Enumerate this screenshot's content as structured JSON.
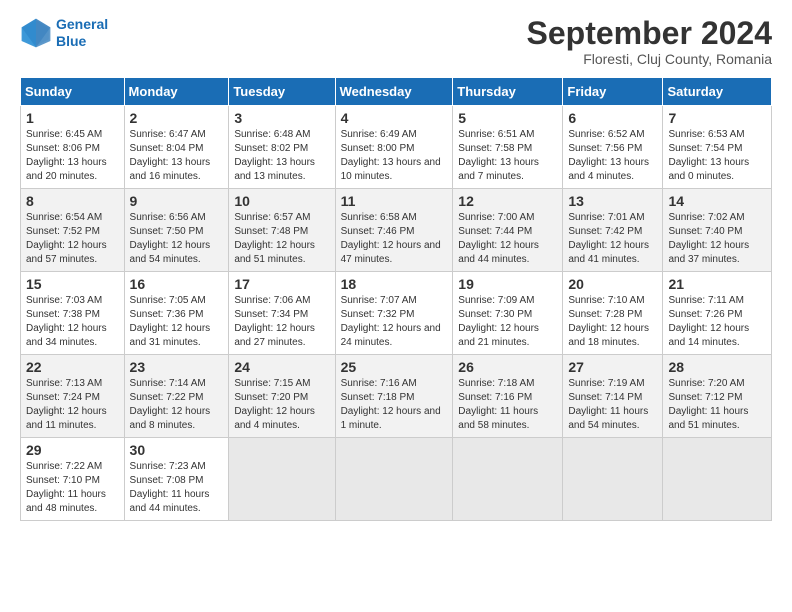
{
  "header": {
    "logo_line1": "General",
    "logo_line2": "Blue",
    "month_title": "September 2024",
    "subtitle": "Floresti, Cluj County, Romania"
  },
  "days_of_week": [
    "Sunday",
    "Monday",
    "Tuesday",
    "Wednesday",
    "Thursday",
    "Friday",
    "Saturday"
  ],
  "weeks": [
    [
      {
        "day": "1",
        "sunrise": "6:45 AM",
        "sunset": "8:06 PM",
        "daylight": "13 hours and 20 minutes."
      },
      {
        "day": "2",
        "sunrise": "6:47 AM",
        "sunset": "8:04 PM",
        "daylight": "13 hours and 16 minutes."
      },
      {
        "day": "3",
        "sunrise": "6:48 AM",
        "sunset": "8:02 PM",
        "daylight": "13 hours and 13 minutes."
      },
      {
        "day": "4",
        "sunrise": "6:49 AM",
        "sunset": "8:00 PM",
        "daylight": "13 hours and 10 minutes."
      },
      {
        "day": "5",
        "sunrise": "6:51 AM",
        "sunset": "7:58 PM",
        "daylight": "13 hours and 7 minutes."
      },
      {
        "day": "6",
        "sunrise": "6:52 AM",
        "sunset": "7:56 PM",
        "daylight": "13 hours and 4 minutes."
      },
      {
        "day": "7",
        "sunrise": "6:53 AM",
        "sunset": "7:54 PM",
        "daylight": "13 hours and 0 minutes."
      }
    ],
    [
      {
        "day": "8",
        "sunrise": "6:54 AM",
        "sunset": "7:52 PM",
        "daylight": "12 hours and 57 minutes."
      },
      {
        "day": "9",
        "sunrise": "6:56 AM",
        "sunset": "7:50 PM",
        "daylight": "12 hours and 54 minutes."
      },
      {
        "day": "10",
        "sunrise": "6:57 AM",
        "sunset": "7:48 PM",
        "daylight": "12 hours and 51 minutes."
      },
      {
        "day": "11",
        "sunrise": "6:58 AM",
        "sunset": "7:46 PM",
        "daylight": "12 hours and 47 minutes."
      },
      {
        "day": "12",
        "sunrise": "7:00 AM",
        "sunset": "7:44 PM",
        "daylight": "12 hours and 44 minutes."
      },
      {
        "day": "13",
        "sunrise": "7:01 AM",
        "sunset": "7:42 PM",
        "daylight": "12 hours and 41 minutes."
      },
      {
        "day": "14",
        "sunrise": "7:02 AM",
        "sunset": "7:40 PM",
        "daylight": "12 hours and 37 minutes."
      }
    ],
    [
      {
        "day": "15",
        "sunrise": "7:03 AM",
        "sunset": "7:38 PM",
        "daylight": "12 hours and 34 minutes."
      },
      {
        "day": "16",
        "sunrise": "7:05 AM",
        "sunset": "7:36 PM",
        "daylight": "12 hours and 31 minutes."
      },
      {
        "day": "17",
        "sunrise": "7:06 AM",
        "sunset": "7:34 PM",
        "daylight": "12 hours and 27 minutes."
      },
      {
        "day": "18",
        "sunrise": "7:07 AM",
        "sunset": "7:32 PM",
        "daylight": "12 hours and 24 minutes."
      },
      {
        "day": "19",
        "sunrise": "7:09 AM",
        "sunset": "7:30 PM",
        "daylight": "12 hours and 21 minutes."
      },
      {
        "day": "20",
        "sunrise": "7:10 AM",
        "sunset": "7:28 PM",
        "daylight": "12 hours and 18 minutes."
      },
      {
        "day": "21",
        "sunrise": "7:11 AM",
        "sunset": "7:26 PM",
        "daylight": "12 hours and 14 minutes."
      }
    ],
    [
      {
        "day": "22",
        "sunrise": "7:13 AM",
        "sunset": "7:24 PM",
        "daylight": "12 hours and 11 minutes."
      },
      {
        "day": "23",
        "sunrise": "7:14 AM",
        "sunset": "7:22 PM",
        "daylight": "12 hours and 8 minutes."
      },
      {
        "day": "24",
        "sunrise": "7:15 AM",
        "sunset": "7:20 PM",
        "daylight": "12 hours and 4 minutes."
      },
      {
        "day": "25",
        "sunrise": "7:16 AM",
        "sunset": "7:18 PM",
        "daylight": "12 hours and 1 minute."
      },
      {
        "day": "26",
        "sunrise": "7:18 AM",
        "sunset": "7:16 PM",
        "daylight": "11 hours and 58 minutes."
      },
      {
        "day": "27",
        "sunrise": "7:19 AM",
        "sunset": "7:14 PM",
        "daylight": "11 hours and 54 minutes."
      },
      {
        "day": "28",
        "sunrise": "7:20 AM",
        "sunset": "7:12 PM",
        "daylight": "11 hours and 51 minutes."
      }
    ],
    [
      {
        "day": "29",
        "sunrise": "7:22 AM",
        "sunset": "7:10 PM",
        "daylight": "11 hours and 48 minutes."
      },
      {
        "day": "30",
        "sunrise": "7:23 AM",
        "sunset": "7:08 PM",
        "daylight": "11 hours and 44 minutes."
      },
      null,
      null,
      null,
      null,
      null
    ]
  ]
}
